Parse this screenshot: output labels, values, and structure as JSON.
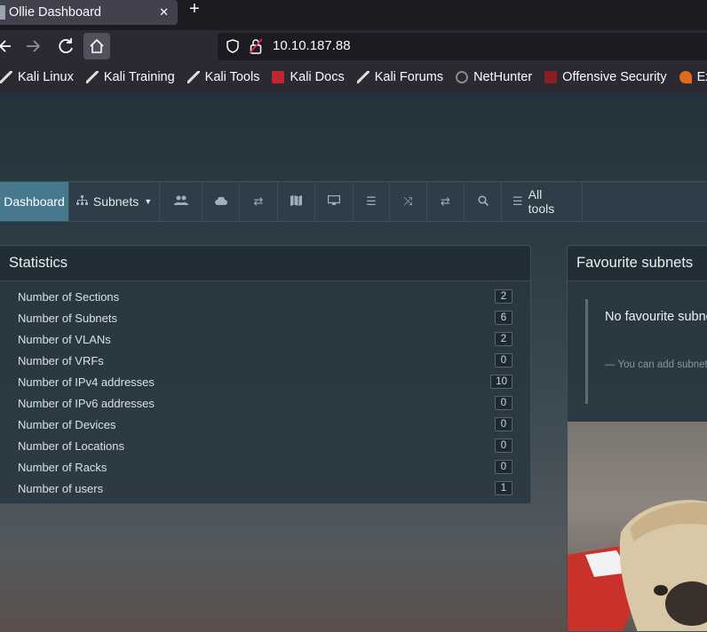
{
  "browser": {
    "tab_title": "Ollie Dashboard",
    "tab_close": "✕",
    "new_tab": "+",
    "url": "10.10.187.88",
    "bookmarks": [
      {
        "label": "Kali Linux",
        "icon": "kali-dragon-icon"
      },
      {
        "label": "Kali Training",
        "icon": "kali-dragon-icon"
      },
      {
        "label": "Kali Tools",
        "icon": "kali-dragon-icon"
      },
      {
        "label": "Kali Docs",
        "icon": "docs-icon"
      },
      {
        "label": "Kali Forums",
        "icon": "kali-dragon-icon"
      },
      {
        "label": "NetHunter",
        "icon": "nethunter-icon"
      },
      {
        "label": "Offensive Security",
        "icon": "offsec-icon"
      },
      {
        "label": "Exploit",
        "icon": "exploit-icon"
      }
    ]
  },
  "menu": {
    "dashboard": "Dashboard",
    "subnets": "Subnets",
    "all_tools": "All tools",
    "icons": [
      "users-icon",
      "cloud-icon",
      "arrows-icon",
      "map-icon",
      "monitor-icon",
      "list-icon",
      "shuffle-icon",
      "exchange-icon",
      "search-icon"
    ]
  },
  "statistics": {
    "title": "Statistics",
    "rows": [
      {
        "label": "Number of Sections",
        "value": "2"
      },
      {
        "label": "Number of Subnets",
        "value": "6"
      },
      {
        "label": "Number of VLANs",
        "value": "2"
      },
      {
        "label": "Number of VRFs",
        "value": "0"
      },
      {
        "label": "Number of IPv4 addresses",
        "value": "10"
      },
      {
        "label": "Number of IPv6 addresses",
        "value": "0"
      },
      {
        "label": "Number of Devices",
        "value": "0"
      },
      {
        "label": "Number of Locations",
        "value": "0"
      },
      {
        "label": "Number of Racks",
        "value": "0"
      },
      {
        "label": "Number of users",
        "value": "1"
      }
    ]
  },
  "favourites": {
    "title": "Favourite subnets",
    "empty_title": "No favourite subnets",
    "hint": "— You can add subnets to favourites"
  },
  "colors": {
    "active_menu": "#46788e",
    "chrome_bg": "#2b2a33"
  }
}
